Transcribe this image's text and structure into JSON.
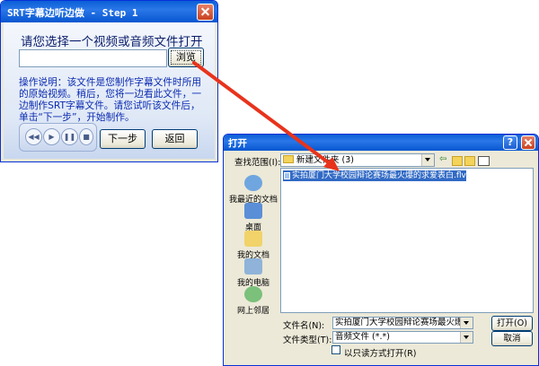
{
  "srt_window": {
    "title": "SRT字幕边听边做 - Step 1",
    "prompt": "请您选择一个视频或音频文件打开",
    "file_path_value": "",
    "browse_label": "浏览",
    "description": "操作说明：该文件是您制作字幕文件时所用的原始视频。稍后，您将一边看此文件，一边制作SRT字幕文件。请您试听该文件后，单击“下一步”，开始制作。",
    "next_label": "下一步",
    "back_label": "返回"
  },
  "open_dialog": {
    "title": "打开",
    "look_in_label": "查找范围(I):",
    "look_in_value": "新建文件夹 (3)",
    "places": [
      {
        "label": "我最近的文档",
        "icon": "recent-documents-icon"
      },
      {
        "label": "桌面",
        "icon": "desktop-icon"
      },
      {
        "label": "我的文档",
        "icon": "my-documents-icon"
      },
      {
        "label": "我的电脑",
        "icon": "my-computer-icon"
      },
      {
        "label": "网上邻居",
        "icon": "network-places-icon"
      }
    ],
    "files": [
      "实拍厦门大学校园辩论赛场最火爆的求爱表白.flv"
    ],
    "filename_label": "文件名(N):",
    "filename_value": "实拍厦门大学校园辩论赛场最火爆的求爱表白",
    "filetype_label": "文件类型(T):",
    "filetype_value": "音频文件 (*.*)",
    "readonly_label": "以只读方式打开(R)",
    "open_label": "打开(O)",
    "cancel_label": "取消"
  },
  "colors": {
    "title_bar": "#0a5fd6",
    "arrow": "#e8331c",
    "selection": "#316ac5"
  }
}
